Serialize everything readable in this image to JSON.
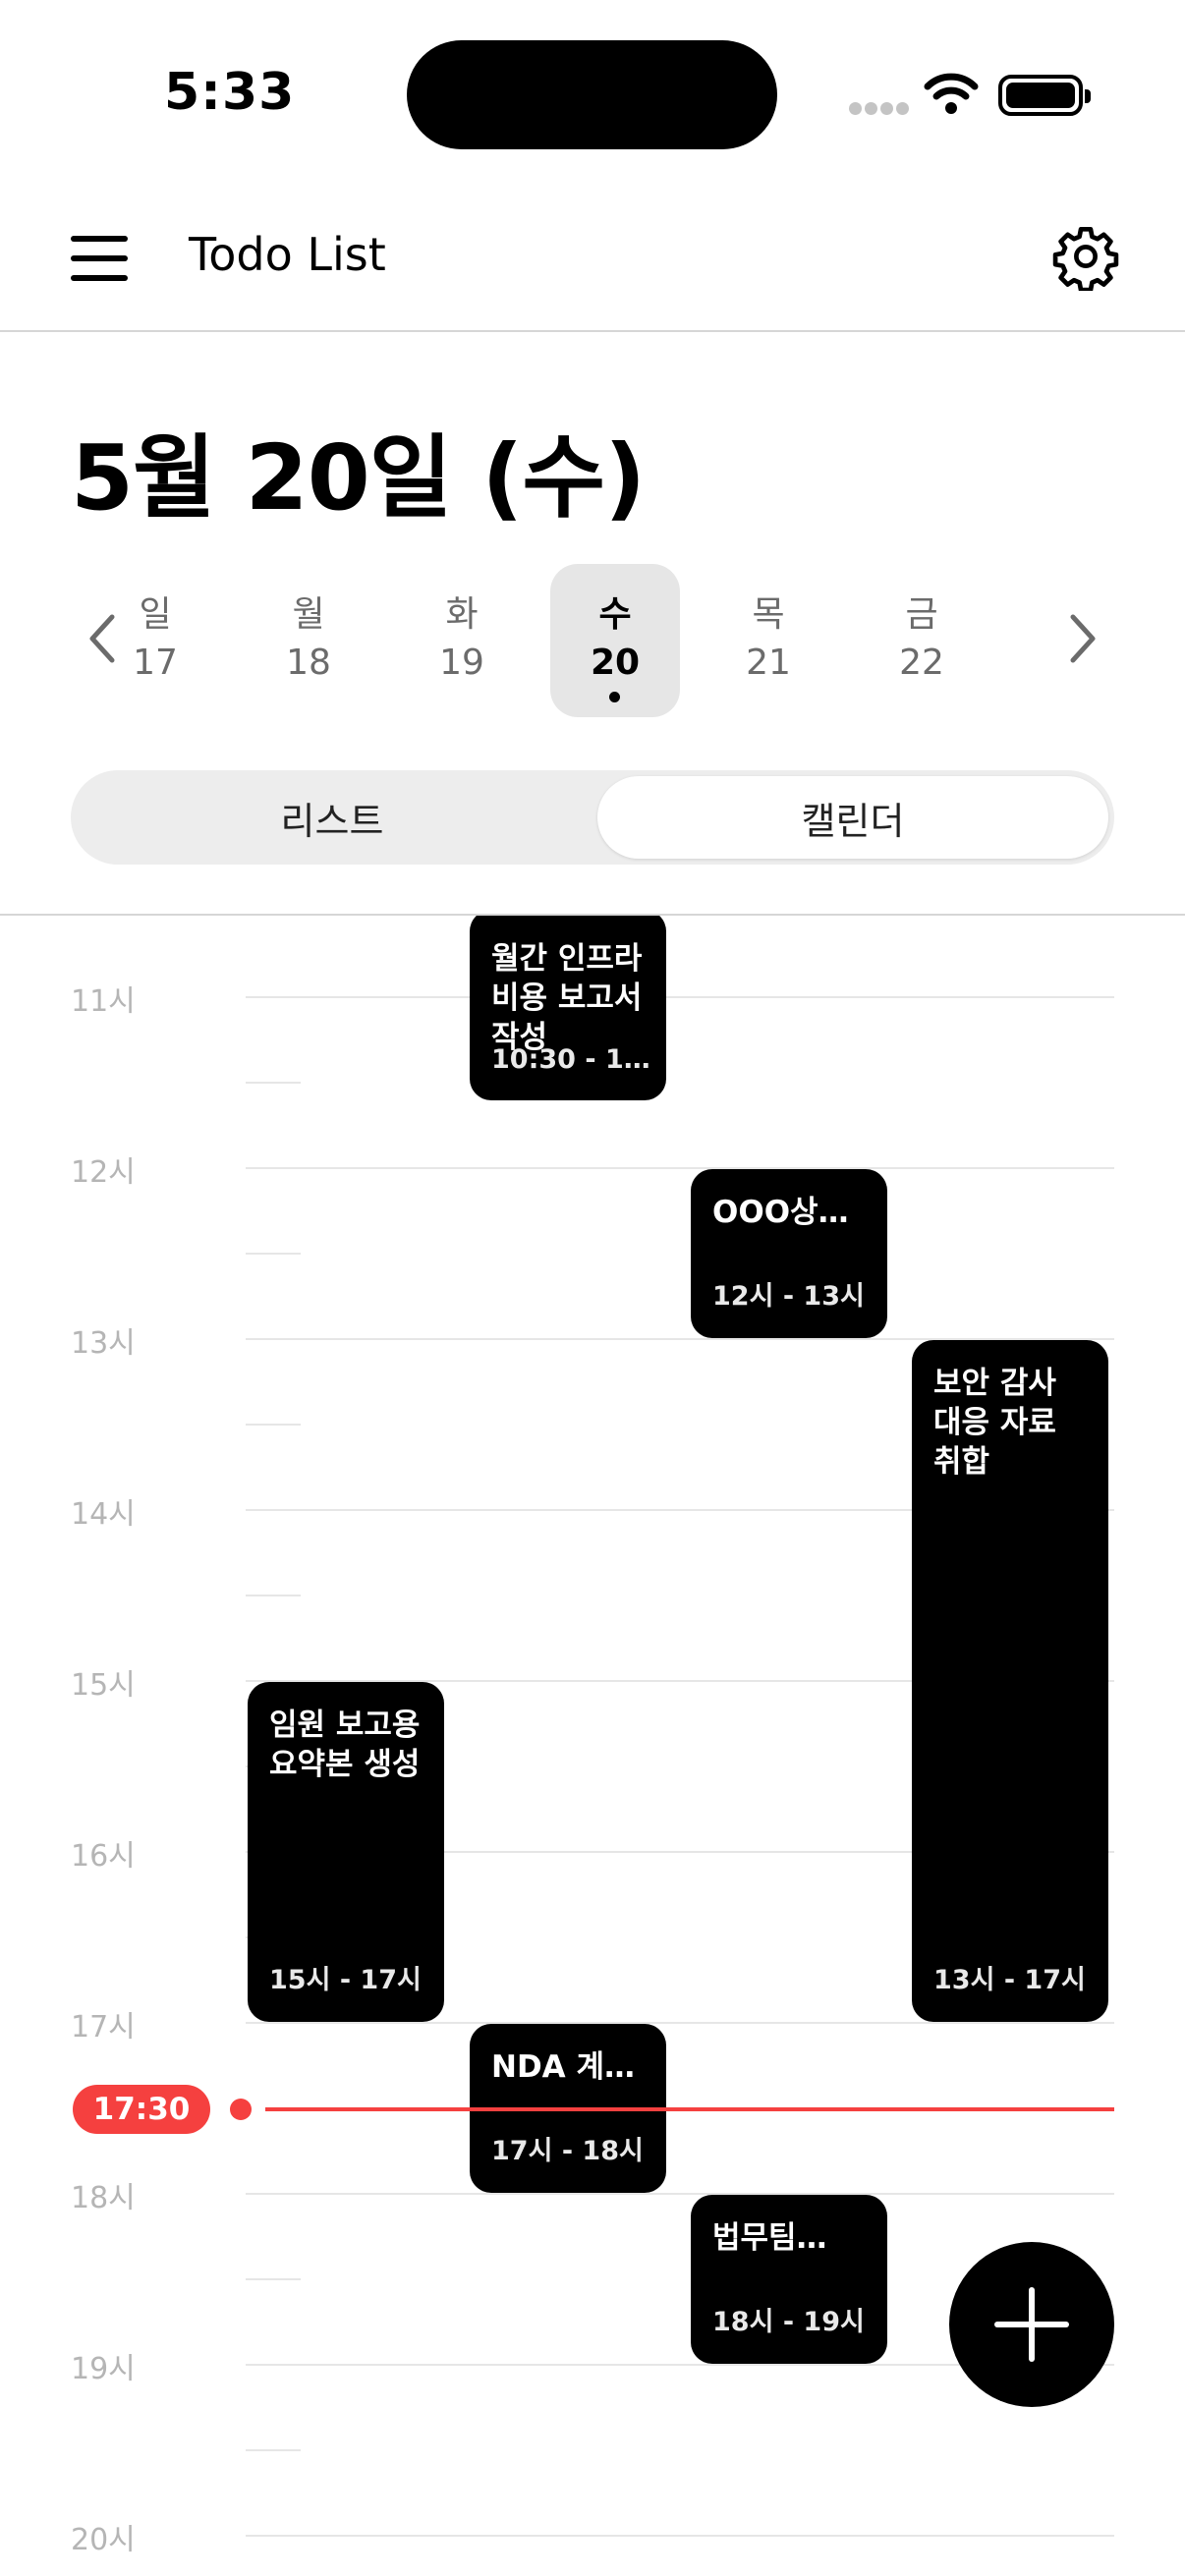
{
  "status_bar": {
    "time": "5:33"
  },
  "header": {
    "title": "Todo List"
  },
  "date_title": "5월 20일 (수)",
  "week": [
    {
      "weekday": "일",
      "day": "17"
    },
    {
      "weekday": "월",
      "day": "18"
    },
    {
      "weekday": "화",
      "day": "19"
    },
    {
      "weekday": "수",
      "day": "20",
      "selected": true
    },
    {
      "weekday": "목",
      "day": "21"
    },
    {
      "weekday": "금",
      "day": "22"
    }
  ],
  "segments": {
    "list": "리스트",
    "calendar": "캘린더",
    "active": "calendar"
  },
  "hours": [
    "11시",
    "12시",
    "13시",
    "14시",
    "15시",
    "16시",
    "17시",
    "18시",
    "19시",
    "20시"
  ],
  "events": [
    {
      "title": "월간 인프라 비용 보고서 작성",
      "time": "10:30 - 1…"
    },
    {
      "title": "OOO상…",
      "time": "12시 - 13시"
    },
    {
      "title": "보안 감사 대응 자료 취합",
      "time": "13시 - 17시"
    },
    {
      "title": "임원 보고용 요약본 생성",
      "time": "15시 - 17시"
    },
    {
      "title": "NDA 계…",
      "time": "17시 - 18시"
    },
    {
      "title": "법무팀…",
      "time": "18시 - 19시"
    }
  ],
  "now": {
    "time": "17:30"
  },
  "colors": {
    "accent_red": "#f5403f",
    "event_bg": "#000000",
    "selected_day_bg": "#e6e6e6"
  },
  "icons": [
    "menu-icon",
    "gear-icon",
    "chevron-left-icon",
    "chevron-right-icon",
    "plus-icon"
  ]
}
